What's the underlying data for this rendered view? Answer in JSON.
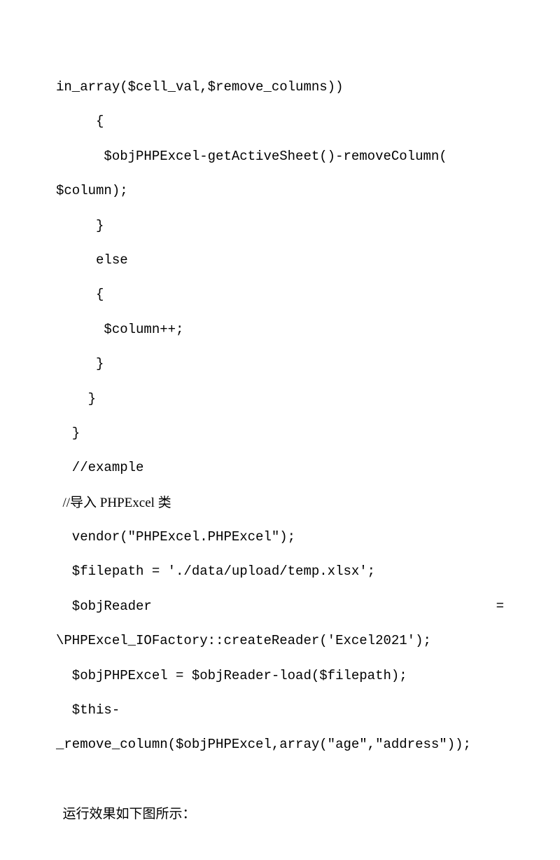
{
  "lines": {
    "l1": "in_array($cell_val,$remove_columns))",
    "l2": "     {",
    "l3": "      $objPHPExcel-getActiveSheet()-removeColumn(",
    "l4": "$column);",
    "l5": "     }",
    "l6": "     else",
    "l7": "     {",
    "l8": "      $column++;",
    "l9": "     }",
    "l10": "    }",
    "l11": "  }",
    "l12": "  //example",
    "l13": "  //导入 PHPExcel 类",
    "l14": "  vendor(\"PHPExcel.PHPExcel\");",
    "l15": "  $filepath = './data/upload/temp.xlsx';",
    "l16_left": "  $objReader",
    "l16_right": "=",
    "l17": "\\PHPExcel_IOFactory::createReader('Excel2021');",
    "l18": "  $objPHPExcel = $objReader-load($filepath);",
    "l19": "  $this-",
    "l20": "_remove_column($objPHPExcel,array(\"age\",\"address\"));",
    "blank": " ",
    "l21": "  运行效果如下图所示："
  }
}
